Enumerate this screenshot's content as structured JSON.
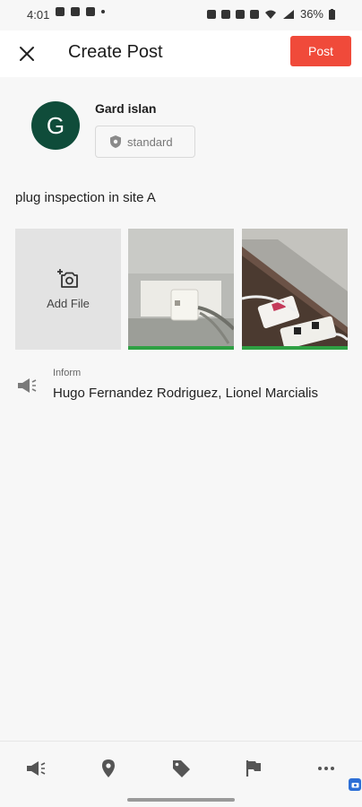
{
  "status_bar": {
    "time": "4:01",
    "battery": "36%"
  },
  "header": {
    "title": "Create Post",
    "post_label": "Post"
  },
  "author": {
    "avatar_initial": "G",
    "name": "Gard islan",
    "visibility": "standard"
  },
  "post": {
    "text": "plug inspection in site A"
  },
  "attachments": {
    "add_file_label": "Add File",
    "thumbnail_count": 2
  },
  "inform": {
    "caption": "Inform",
    "recipients": "Hugo Fernandez Rodriguez, Lionel Marcialis"
  },
  "toolbar": {
    "icons": [
      "megaphone-icon",
      "location-pin-icon",
      "tag-icon",
      "flag-icon",
      "more-icon"
    ]
  },
  "colors": {
    "accent": "#f04a3a",
    "avatar_bg": "#0f4c3a",
    "upload_complete": "#2ea043"
  }
}
